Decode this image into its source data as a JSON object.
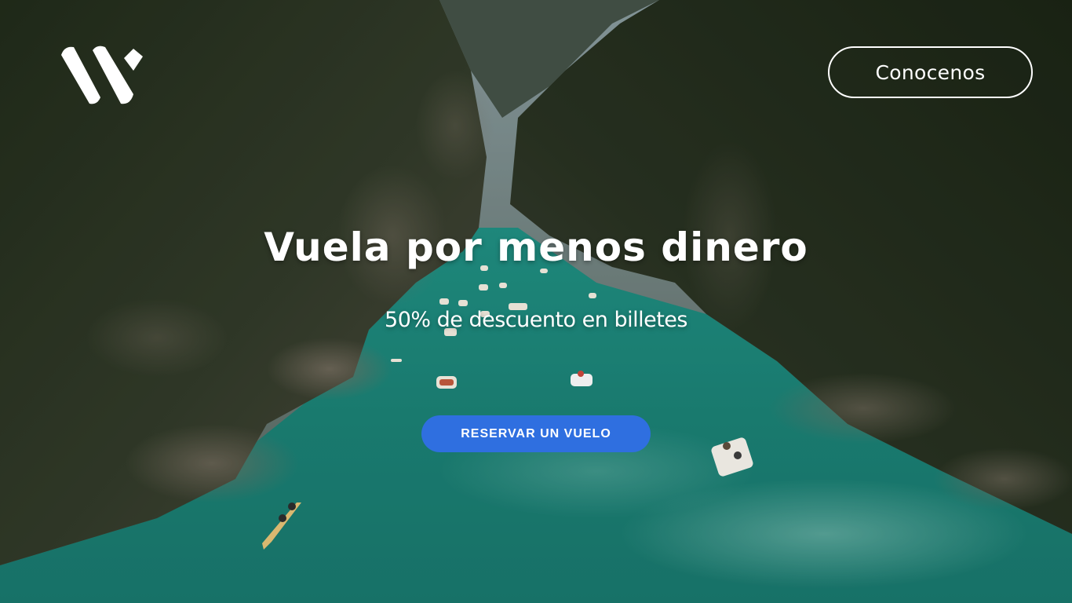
{
  "header": {
    "logo_icon": "w-logo-icon",
    "nav_button_label": "Conocenos"
  },
  "hero": {
    "title": "Vuela por menos dinero",
    "subtitle": "50% de descuento en billetes",
    "cta_label": "RESERVAR UN VUELO",
    "background_icon": "canyon-river-photo"
  },
  "colors": {
    "cta_background": "#2f6fe0",
    "text": "#ffffff",
    "water": "#1f9a8c",
    "forest": "#2c3a24"
  }
}
